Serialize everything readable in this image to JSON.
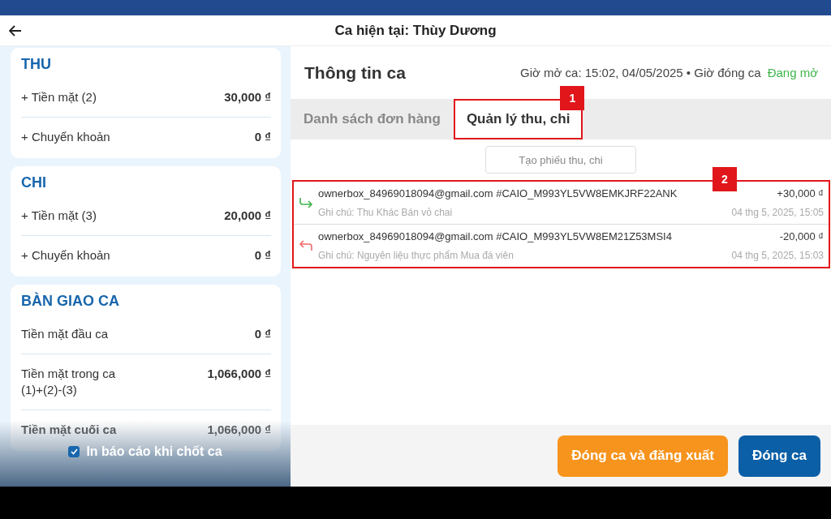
{
  "header": {
    "title": "Ca hiện tại: Thùy Dương"
  },
  "summary_cards": [
    {
      "title": "THU",
      "rows": [
        {
          "label": "+ Tiền mặt (2)",
          "value": "30,000 ₫",
          "emphasis": false
        },
        {
          "label": "+ Chuyển khoản",
          "value": "0 ₫",
          "emphasis": false
        }
      ]
    },
    {
      "title": "CHI",
      "rows": [
        {
          "label": "+ Tiền mặt (3)",
          "value": "20,000 ₫",
          "emphasis": false
        },
        {
          "label": "+ Chuyển khoản",
          "value": "0 ₫",
          "emphasis": false
        }
      ]
    },
    {
      "title": "BÀN GIAO CA",
      "rows": [
        {
          "label": "Tiền mặt đầu ca",
          "value": "0 ₫",
          "emphasis": false
        },
        {
          "label": "Tiền mặt trong ca\n(1)+(2)-(3)",
          "value": "1,066,000 ₫",
          "emphasis": false
        },
        {
          "label": "Tiền mặt cuối ca",
          "value": "1,066,000 ₫",
          "emphasis": true
        }
      ]
    }
  ],
  "print_option": {
    "label": "In báo cáo khi chốt ca",
    "checked": true
  },
  "shift_info": {
    "title": "Thông tin ca",
    "times": "Giờ mở ca: 15:02, 04/05/2025 • Giờ đóng ca",
    "status": "Đang mở"
  },
  "tabs": [
    {
      "label": "Danh sách đơn hàng",
      "selected": false
    },
    {
      "label": "Quản lý thu, chi",
      "selected": true,
      "callout": "1"
    }
  ],
  "create_button": "Tạo phiếu thu, chi",
  "transactions_callout": "2",
  "transactions": [
    {
      "kind": "in",
      "title": "ownerbox_84969018094@gmail.com #CAIO_M993YL5VW8EMKJRF22ANK",
      "note": "Ghi chú: Thu Khác Bán vỏ chai",
      "amount": "+30,000 ₫",
      "time": "04 thg 5, 2025, 15:05"
    },
    {
      "kind": "out",
      "title": "ownerbox_84969018094@gmail.com #CAIO_M993YL5VW8EM21Z53MSI4",
      "note": "Ghi chú: Nguyên liệu thực phẩm Mua đá viên",
      "amount": "-20,000 ₫",
      "time": "04 thg 5, 2025, 15:03"
    }
  ],
  "actions": [
    {
      "kind": "secondary",
      "label": "Đóng ca và đăng xuất"
    },
    {
      "kind": "primary",
      "label": "Đóng ca"
    }
  ]
}
